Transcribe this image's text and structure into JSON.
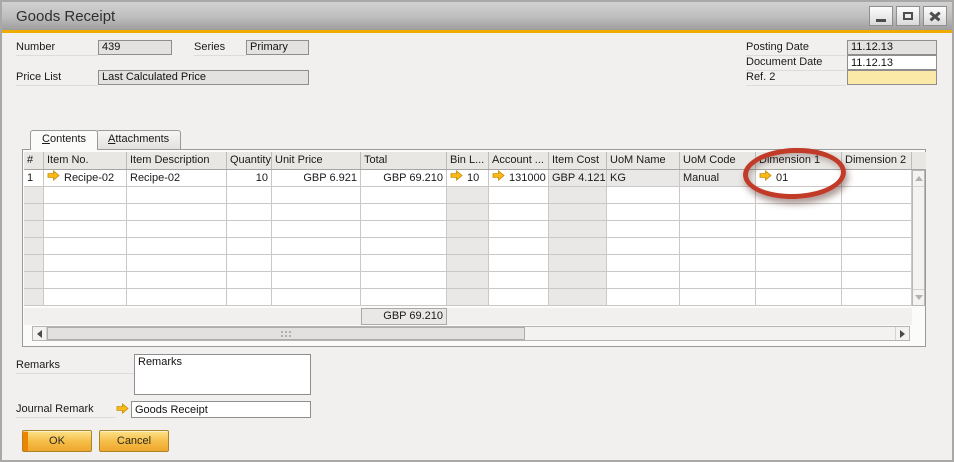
{
  "window": {
    "title": "Goods Receipt"
  },
  "form": {
    "number_label": "Number",
    "number_value": "439",
    "series_label": "Series",
    "series_value": "Primary",
    "price_list_label": "Price List",
    "price_list_value": "Last Calculated Price",
    "posting_date_label": "Posting Date",
    "posting_date_value": "11.12.13",
    "document_date_label": "Document Date",
    "document_date_value": "11.12.13",
    "ref2_label": "Ref. 2",
    "ref2_value": ""
  },
  "tabs": {
    "contents": "Contents",
    "attachments": "Attachments"
  },
  "table": {
    "columns": [
      "#",
      "Item No.",
      "Item Description",
      "Quantity",
      "Unit Price",
      "Total",
      "Bin L...",
      "Account ...",
      "Item Cost",
      "UoM Name",
      "UoM Code",
      "Dimension 1",
      "Dimension 2"
    ],
    "row": {
      "num": "1",
      "item_no": "Recipe-02",
      "item_description": "Recipe-02",
      "quantity": "10",
      "unit_price": "GBP 6.921",
      "total": "GBP 69.210",
      "bin_location": "10",
      "account": "131000",
      "item_cost": "GBP 4.121",
      "uom_name": "KG",
      "uom_code": "Manual",
      "dimension_1": "01",
      "dimension_2": ""
    },
    "empty_rows": 7,
    "total_sum": "GBP 69.210"
  },
  "footer": {
    "remarks_label": "Remarks",
    "remarks_value": "Remarks",
    "journal_remark_label": "Journal Remark",
    "journal_remark_value": "Goods Receipt",
    "ok_label": "OK",
    "cancel_label": "Cancel"
  },
  "colors": {
    "accent_line": "#f0ab00",
    "ref2_field_bg": "#fbe9a7",
    "link_arrow": "#f9b916",
    "annotation_circle": "#c23a28",
    "button_gold": "#f5bc45"
  },
  "icons": {
    "minimize": "minimize-icon",
    "maximize": "maximize-icon",
    "close": "close-icon",
    "link_arrow": "link-arrow-icon"
  }
}
